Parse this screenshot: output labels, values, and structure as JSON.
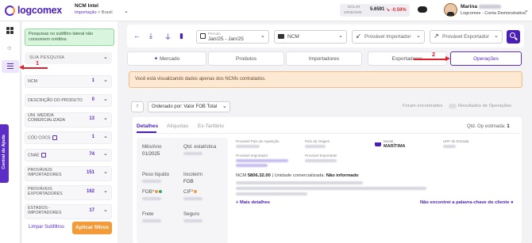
{
  "brand": {
    "name": "logcomex",
    "colors": {
      "primary": "#4a1fb8",
      "accent": "#f39b38",
      "annotation": "#e0202a"
    }
  },
  "header": {
    "ncm_title": "NCM Intel",
    "breadcrumb_link": "Importação",
    "breadcrumb_sep": ">",
    "breadcrumb_current": "Brasil",
    "dolar": {
      "label": "DÓLAR",
      "date": "20/05/2025",
      "value": "5.6591",
      "change": "-0.59%"
    },
    "user": {
      "name": "Marina",
      "company": "Logcomex - Conta Demonstrativa"
    }
  },
  "rail": {
    "help_label": "Central de Ajuda"
  },
  "filters": {
    "notice": "Pesquisas no subfiltro lateral não consomem créditos.",
    "search_label": "SUA PESQUISA",
    "rows": [
      {
        "label": "NCM",
        "count": "1"
      },
      {
        "label": "DESCRIÇÃO DO PRODUTO",
        "count": "0"
      },
      {
        "label": "UNI. MEDIDA COMERCIALIZADA",
        "count": "13"
      },
      {
        "label": "CÓD COCS",
        "count": "1"
      },
      {
        "label": "CNAE",
        "count": "74"
      },
      {
        "label": "PROVÁVEIS IMPORTADORES",
        "count": "151"
      },
      {
        "label": "PROVÁVEIS EXPORTADORES",
        "count": "162"
      },
      {
        "label": "ESTADOS - IMPORTADORES",
        "count": "17"
      }
    ],
    "clear_label": "Limpar Subfiltros",
    "apply_label": "Aplicar filtros"
  },
  "annotations": {
    "one": "1",
    "two": "2"
  },
  "toolbar": {
    "period_label": "Período",
    "period_value": "Jan/25 - Jan/25",
    "ncm_value": "NCM",
    "importer_placeholder": "Provável Importador",
    "exporter_placeholder": "Provável Exportador"
  },
  "tabs": [
    {
      "label": "Mercado",
      "active": false
    },
    {
      "label": "Produtos",
      "active": false
    },
    {
      "label": "Importadores",
      "active": false
    },
    {
      "label": "Exportadores",
      "active": false
    },
    {
      "label": "Operações",
      "active": true
    }
  ],
  "warning": "Você está visualizando dados apenas dos NCMs contratados.",
  "order": {
    "label": "Ordenado por: Valor FOB Total",
    "found_label": "Foram encontrados",
    "found_suffix": "Resultados de Operações"
  },
  "details": {
    "tabs": [
      "Detalhes",
      "Alíquotas",
      "Ex-Tarifário"
    ],
    "qtd_op_label": "Qtd. Op estimada:",
    "qtd_op_value": "1",
    "left": {
      "mes_ano_label": "Mês/Ano",
      "mes_ano_value": "01/2025",
      "qtd_label": "Qtd. estatística",
      "peso_label": "Peso líquido",
      "incoterm_label": "Incoterm",
      "incoterm_value": "FOB",
      "fob_label": "FOB*",
      "cif_label": "CIF*",
      "frete_label": "Frete",
      "seguro_label": "Seguro"
    },
    "right": {
      "pais_aquisicao_label": "Provável País de Aquisição",
      "pais_origem_label": "País de Origem",
      "modal_label": "Modal",
      "modal_value": "MARÍTIMA",
      "urf_label": "URF de Entrada",
      "importador_label": "Provável Importador",
      "exportador_label": "Provável Exportador",
      "ncm_prefix": "NCM",
      "ncm_value": "5806.32.00",
      "unidade_label": "Unidade comercializada:",
      "unidade_value": "Não informado",
      "mais_detalhes": "+ Mais detalhes",
      "nao_encontrei": "Não encontrei a palavra-chave do cliente"
    }
  }
}
